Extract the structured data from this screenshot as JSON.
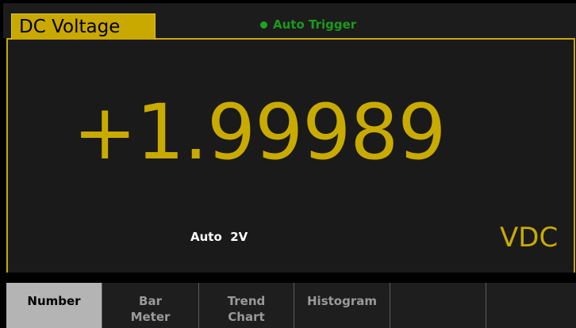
{
  "header": {
    "function_label": "DC Voltage",
    "trigger_label": "Auto Trigger",
    "trigger_status_color": "#1ea51e"
  },
  "measurement": {
    "value": "+1.99989",
    "range": "Auto  2V",
    "unit": "VDC",
    "accent_color": "#c9a800"
  },
  "softkeys": [
    {
      "label": "Number",
      "selected": true
    },
    {
      "label": "Bar\nMeter",
      "selected": false
    },
    {
      "label": "Trend\nChart",
      "selected": false
    },
    {
      "label": "Histogram",
      "selected": false
    },
    {
      "label": "",
      "selected": false
    },
    {
      "label": "",
      "selected": false
    }
  ]
}
